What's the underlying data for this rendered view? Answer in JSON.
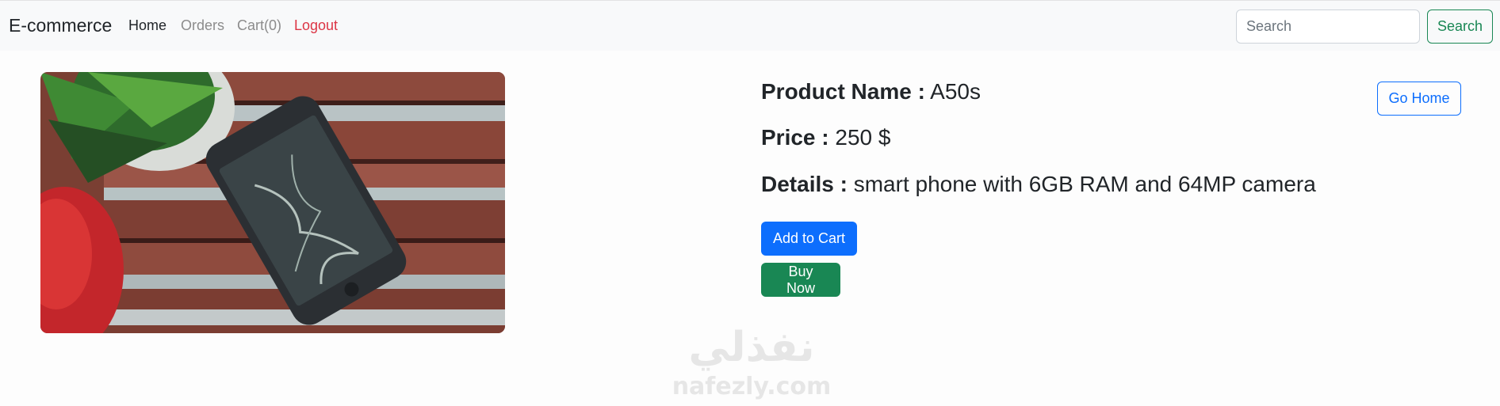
{
  "navbar": {
    "brand": "E-commerce",
    "links": [
      "Home",
      "Orders",
      "Cart(0)",
      "Logout"
    ],
    "search_placeholder": "Search",
    "search_button": "Search"
  },
  "product": {
    "image_description": "smartphone lying on wooden bench next to plant",
    "name_label": "Product Name :",
    "name": "A50s",
    "price_label": "Price :",
    "price": "250 $",
    "details_label": "Details :",
    "details": "smart phone with 6GB RAM and 64MP camera"
  },
  "actions": {
    "add_to_cart": "Add to Cart",
    "buy_now": "Buy Now",
    "go_home": "Go Home"
  },
  "watermark": {
    "arabic": "نفذلي",
    "latin": "nafezly.com"
  },
  "colors": {
    "primary": "#0d6efd",
    "success": "#198754",
    "danger": "#dc3545",
    "navbar_bg": "#f8f9fa"
  }
}
